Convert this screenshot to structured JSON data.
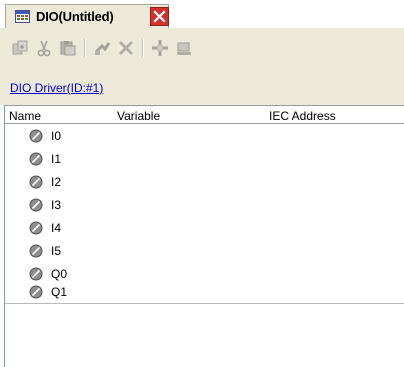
{
  "tab": {
    "icon": "dio-grid-icon",
    "title": "DIO(Untitled)",
    "close_icon": "close-icon",
    "close_color": "#d4302b"
  },
  "toolbar": {
    "buttons": [
      {
        "icon": "add-icon",
        "enabled": false
      },
      {
        "icon": "cut-icon",
        "enabled": false
      },
      {
        "icon": "paste-icon",
        "enabled": false
      },
      {
        "icon": "insert-icon",
        "enabled": false
      },
      {
        "icon": "delete-x-icon",
        "enabled": false
      },
      {
        "icon": "move-icon",
        "enabled": false
      },
      {
        "icon": "window-icon",
        "enabled": false
      }
    ]
  },
  "driver_link": "DIO Driver(ID:#1)",
  "table": {
    "columns": [
      "Name",
      "Variable",
      "IEC Address"
    ],
    "rows": [
      {
        "name": "I0",
        "variable": "",
        "iec_address": ""
      },
      {
        "name": "I1",
        "variable": "",
        "iec_address": ""
      },
      {
        "name": "I2",
        "variable": "",
        "iec_address": ""
      },
      {
        "name": "I3",
        "variable": "",
        "iec_address": ""
      },
      {
        "name": "I4",
        "variable": "",
        "iec_address": ""
      },
      {
        "name": "I5",
        "variable": "",
        "iec_address": ""
      },
      {
        "name": "Q0",
        "variable": "",
        "iec_address": ""
      },
      {
        "name": "Q1",
        "variable": "",
        "iec_address": ""
      }
    ],
    "row_icon": "unassigned-terminal-icon"
  },
  "colors": {
    "panel_bg": "#ece9d8",
    "link": "#0000cc",
    "close": "#d4302b"
  }
}
